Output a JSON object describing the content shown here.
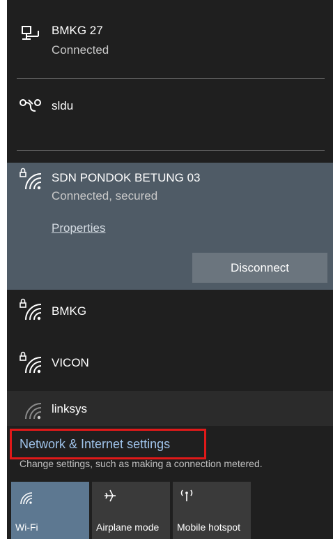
{
  "networks": {
    "wired": {
      "name": "BMKG 27",
      "status": "Connected",
      "icon": "ethernet-icon"
    },
    "dialup": {
      "name": "sldu",
      "icon": "dialup-icon"
    },
    "selected": {
      "name": "SDN PONDOK BETUNG 03",
      "status": "Connected, secured",
      "properties_label": "Properties",
      "disconnect_label": "Disconnect",
      "icon": "wifi-secured-icon"
    },
    "list": [
      {
        "name": "BMKG",
        "icon": "wifi-secured-icon"
      },
      {
        "name": "VICON",
        "icon": "wifi-secured-icon"
      },
      {
        "name": "linksys",
        "icon": "wifi-open-icon"
      }
    ]
  },
  "settings": {
    "link": "Network & Internet settings",
    "description": "Change settings, such as making a connection metered."
  },
  "quick_actions": [
    {
      "label": "Wi-Fi",
      "icon": "wifi-icon",
      "active": true
    },
    {
      "label": "Airplane mode",
      "icon": "airplane-icon",
      "active": false
    },
    {
      "label": "Mobile hotspot",
      "icon": "hotspot-icon",
      "active": false
    }
  ],
  "colors": {
    "background": "#1f1f1f",
    "selected_background": "#4f5b66",
    "accent_link": "#9fc3ea",
    "wifi_tile_active": "#5d7891",
    "highlight_border": "#e01919"
  }
}
